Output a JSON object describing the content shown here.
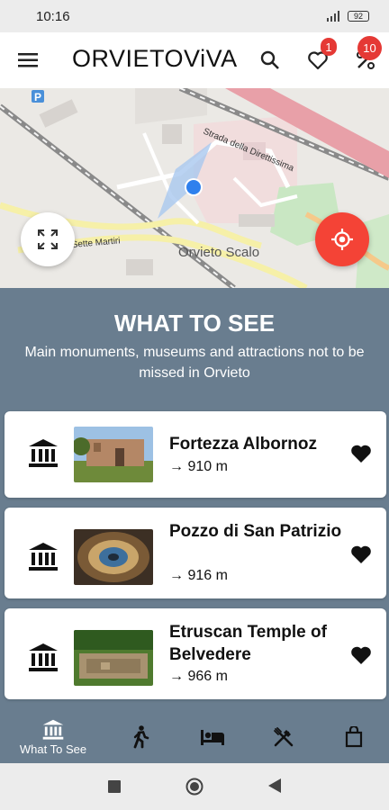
{
  "status_bar": {
    "time": "10:16",
    "battery": "92"
  },
  "header": {
    "logo_prefix": "ORVIETO",
    "logo_suffix": "ViVA",
    "favorites_badge": "1",
    "offers_badge": "10"
  },
  "map": {
    "street_label": "Strada della Direttissima",
    "place_label": "Orvieto Scalo",
    "road_label": "Sette Martiri"
  },
  "section": {
    "title": "WHAT TO SEE",
    "subtitle": "Main monuments, museums and attractions not to be missed in Orvieto"
  },
  "places": [
    {
      "name": "Fortezza Albornoz",
      "distance": "→ 910 m"
    },
    {
      "name": "Pozzo di San Patrizio",
      "distance": "→ 916 m"
    },
    {
      "name": "Etruscan Temple of Belvedere",
      "distance": "→ 966 m"
    }
  ],
  "bottom_nav": {
    "active_label": "What To See"
  },
  "colors": {
    "accent": "#f44336",
    "section_bg": "#697d8f",
    "badge": "#e53935"
  }
}
